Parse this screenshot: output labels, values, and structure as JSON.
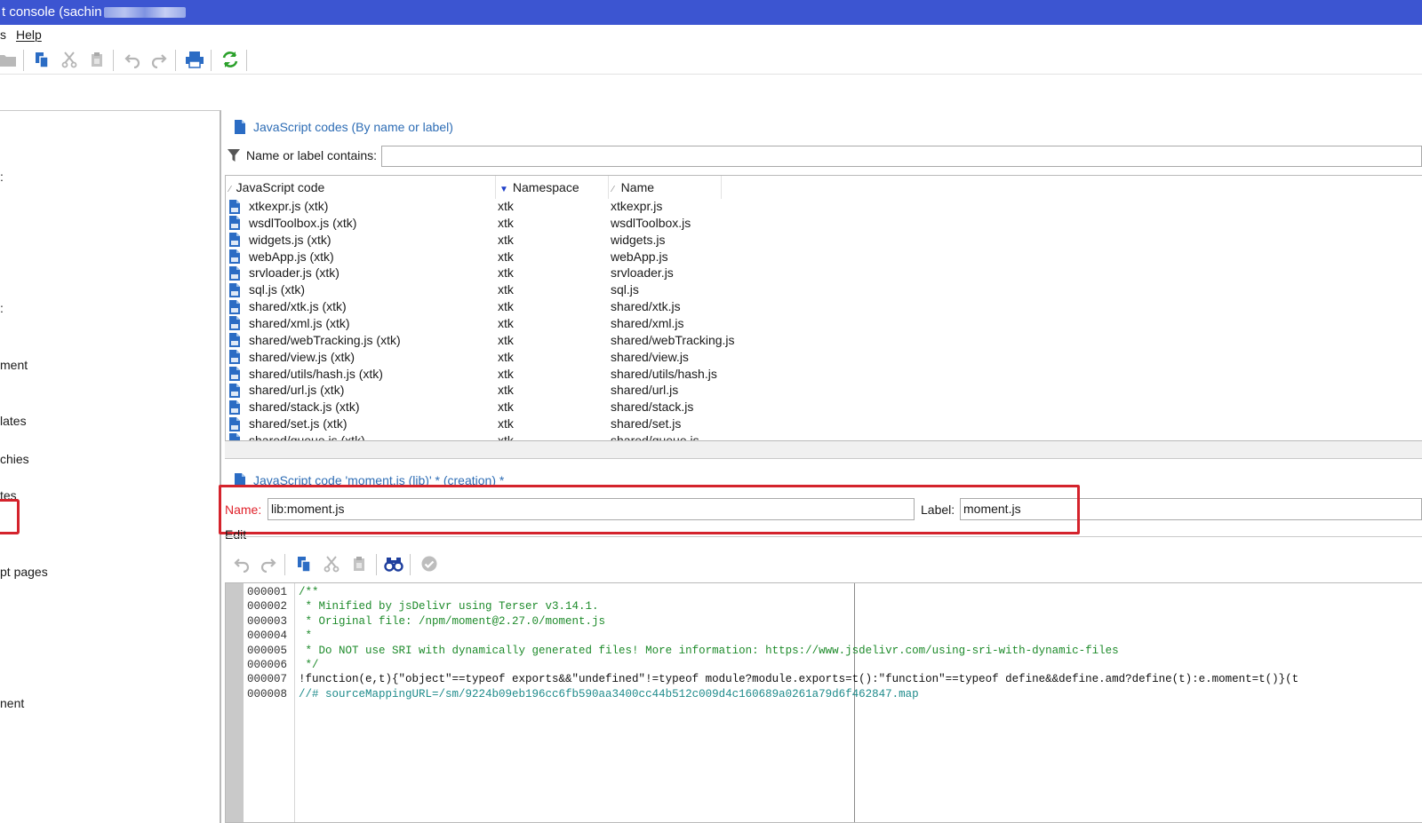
{
  "window": {
    "title": "t console (sachin"
  },
  "menu": {
    "partial_left": "s",
    "help": "Help"
  },
  "toolbar": {
    "icons": [
      "folder-icon",
      "copy-icon",
      "cut-icon",
      "paste-icon",
      "undo-icon",
      "redo-icon",
      "print-icon",
      "refresh-icon"
    ]
  },
  "sidebar": {
    "items": [
      {
        "label": ":"
      },
      {
        "label": ":"
      },
      {
        "label": "ment"
      },
      {
        "label": "lates"
      },
      {
        "label": "chies"
      },
      {
        "label": "tes"
      },
      {
        "label": "pt pages"
      },
      {
        "label": "nent"
      }
    ]
  },
  "list_section": {
    "title": "JavaScript codes (By name or label)",
    "filter_label": "Name or label contains:",
    "filter_value": "",
    "columns": [
      "JavaScript code",
      "Namespace",
      "Name"
    ],
    "rows": [
      {
        "code": "xtkexpr.js (xtk)",
        "namespace": "xtk",
        "name": "xtkexpr.js"
      },
      {
        "code": "wsdlToolbox.js (xtk)",
        "namespace": "xtk",
        "name": "wsdlToolbox.js"
      },
      {
        "code": "widgets.js (xtk)",
        "namespace": "xtk",
        "name": "widgets.js"
      },
      {
        "code": "webApp.js (xtk)",
        "namespace": "xtk",
        "name": "webApp.js"
      },
      {
        "code": "srvloader.js (xtk)",
        "namespace": "xtk",
        "name": "srvloader.js"
      },
      {
        "code": "sql.js (xtk)",
        "namespace": "xtk",
        "name": "sql.js"
      },
      {
        "code": "shared/xtk.js (xtk)",
        "namespace": "xtk",
        "name": "shared/xtk.js"
      },
      {
        "code": "shared/xml.js (xtk)",
        "namespace": "xtk",
        "name": "shared/xml.js"
      },
      {
        "code": "shared/webTracking.js (xtk)",
        "namespace": "xtk",
        "name": "shared/webTracking.js"
      },
      {
        "code": "shared/view.js (xtk)",
        "namespace": "xtk",
        "name": "shared/view.js"
      },
      {
        "code": "shared/utils/hash.js (xtk)",
        "namespace": "xtk",
        "name": "shared/utils/hash.js"
      },
      {
        "code": "shared/url.js (xtk)",
        "namespace": "xtk",
        "name": "shared/url.js"
      },
      {
        "code": "shared/stack.js (xtk)",
        "namespace": "xtk",
        "name": "shared/stack.js"
      },
      {
        "code": "shared/set.js (xtk)",
        "namespace": "xtk",
        "name": "shared/set.js"
      },
      {
        "code": "shared/queue.js (xtk)",
        "namespace": "xtk",
        "name": "shared/queue.js"
      }
    ]
  },
  "detail_section": {
    "title": "JavaScript code 'moment.js (lib)' * (creation) *",
    "name_label": "Name:",
    "name_value": "lib:moment.js",
    "label_label": "Label:",
    "label_value": "moment.js",
    "edit_tab": "Edit"
  },
  "editor": {
    "icons": [
      "undo-icon",
      "redo-icon",
      "copy-icon",
      "cut-icon",
      "paste-icon",
      "find-icon",
      "check-icon"
    ],
    "lines": [
      {
        "num": "000001",
        "text": "/**"
      },
      {
        "num": "000002",
        "text": " * Minified by jsDelivr using Terser v3.14.1."
      },
      {
        "num": "000003",
        "text": " * Original file: /npm/moment@2.27.0/moment.js"
      },
      {
        "num": "000004",
        "text": " *"
      },
      {
        "num": "000005",
        "text": " * Do NOT use SRI with dynamically generated files! More information: https://www.jsdelivr.com/using-sri-with-dynamic-files"
      },
      {
        "num": "000006",
        "text": " */"
      },
      {
        "num": "000007",
        "text": "!function(e,t){\"object\"==typeof exports&&\"undefined\"!=typeof module?module.exports=t():\"function\"==typeof define&&define.amd?define(t):e.moment=t()}(t"
      },
      {
        "num": "000008",
        "text": "//# sourceMappingURL=/sm/9224b09eb196cc6fb590aa3400cc44b512c009d4c160689a0261a79d6f462847.map"
      }
    ]
  },
  "colors": {
    "titlebar": "#3c55d1",
    "section_title": "#2e6db5",
    "highlight": "#d4232c",
    "required_label": "#e0222b",
    "comment": "#1e8b2b",
    "keyword": "#1f2fd6"
  }
}
